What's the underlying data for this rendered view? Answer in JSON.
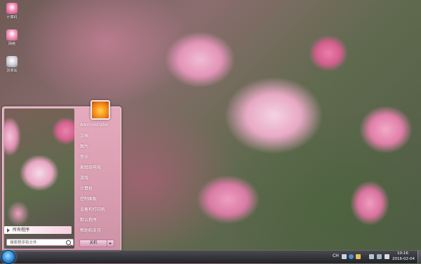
{
  "desktop": {
    "icons": [
      {
        "label": "计算机",
        "color": "#e85d95"
      },
      {
        "label": "网络",
        "color": "#e56aa0"
      },
      {
        "label": "回收站",
        "color": "#c7c7c7"
      }
    ]
  },
  "start_menu": {
    "all_programs_label": "所有程序",
    "search_placeholder": "搜索程序和文件",
    "user_name": "Administrator",
    "right_links": [
      "文档",
      "图片",
      "音乐",
      "游戏",
      "计算机",
      "控制面板",
      "设备和打印机",
      "默认程序",
      "帮助和支持"
    ],
    "right_links_all": [
      "Administrator",
      "文档",
      "图片",
      "音乐",
      "家庭组电视",
      "游戏",
      "计算机",
      "控制面板",
      "设备和打印机",
      "默认程序",
      "帮助和支持"
    ],
    "shutdown_label": "关机",
    "shutdown_arrow": "▸"
  },
  "taskbar": {
    "language_indicator": "CH",
    "clock_time": "10:16",
    "clock_date": "2016-02-04",
    "tray_icons": [
      "keyboard-icon",
      "help-icon",
      "flag-icon",
      "display-icon",
      "network-icon",
      "volume-icon"
    ],
    "accent_color": "#2c86d6"
  }
}
